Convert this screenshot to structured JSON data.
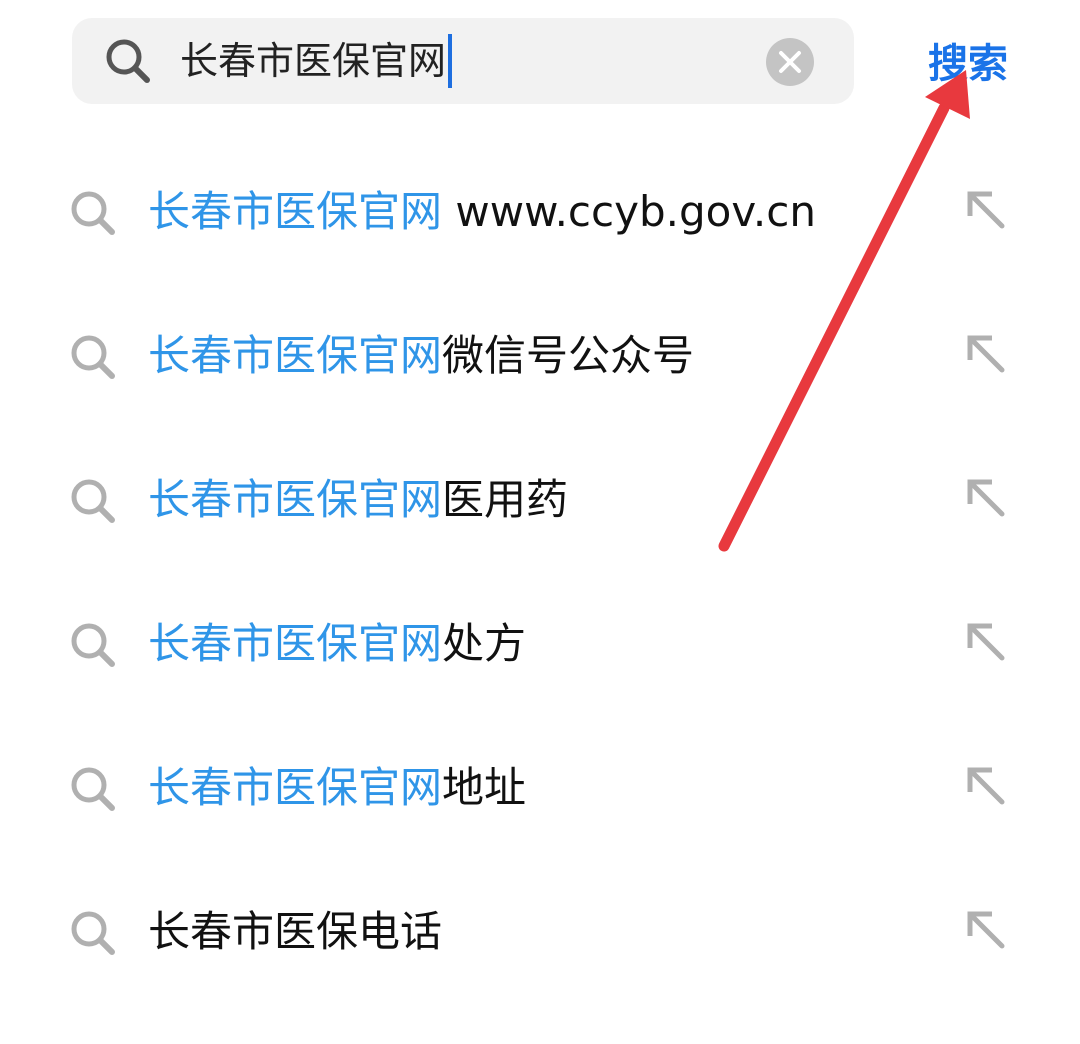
{
  "search": {
    "query": "长春市医保官网",
    "button_label": "搜索"
  },
  "suggestions": [
    {
      "highlight": "长春市医保官网",
      "rest": " www.ccyb.gov.cn"
    },
    {
      "highlight": "长春市医保官网",
      "rest": "微信号公众号"
    },
    {
      "highlight": "长春市医保官网",
      "rest": "医用药"
    },
    {
      "highlight": "长春市医保官网",
      "rest": "处方"
    },
    {
      "highlight": "长春市医保官网",
      "rest": "地址"
    },
    {
      "highlight": "",
      "rest": "长春市医保电话"
    }
  ],
  "icons": {
    "search": "search-icon",
    "clear": "clear-icon",
    "fill": "arrow-up-left-icon"
  },
  "colors": {
    "accent": "#1a73e8",
    "highlight": "#2f95e8",
    "annotation_arrow": "#e8393e"
  }
}
